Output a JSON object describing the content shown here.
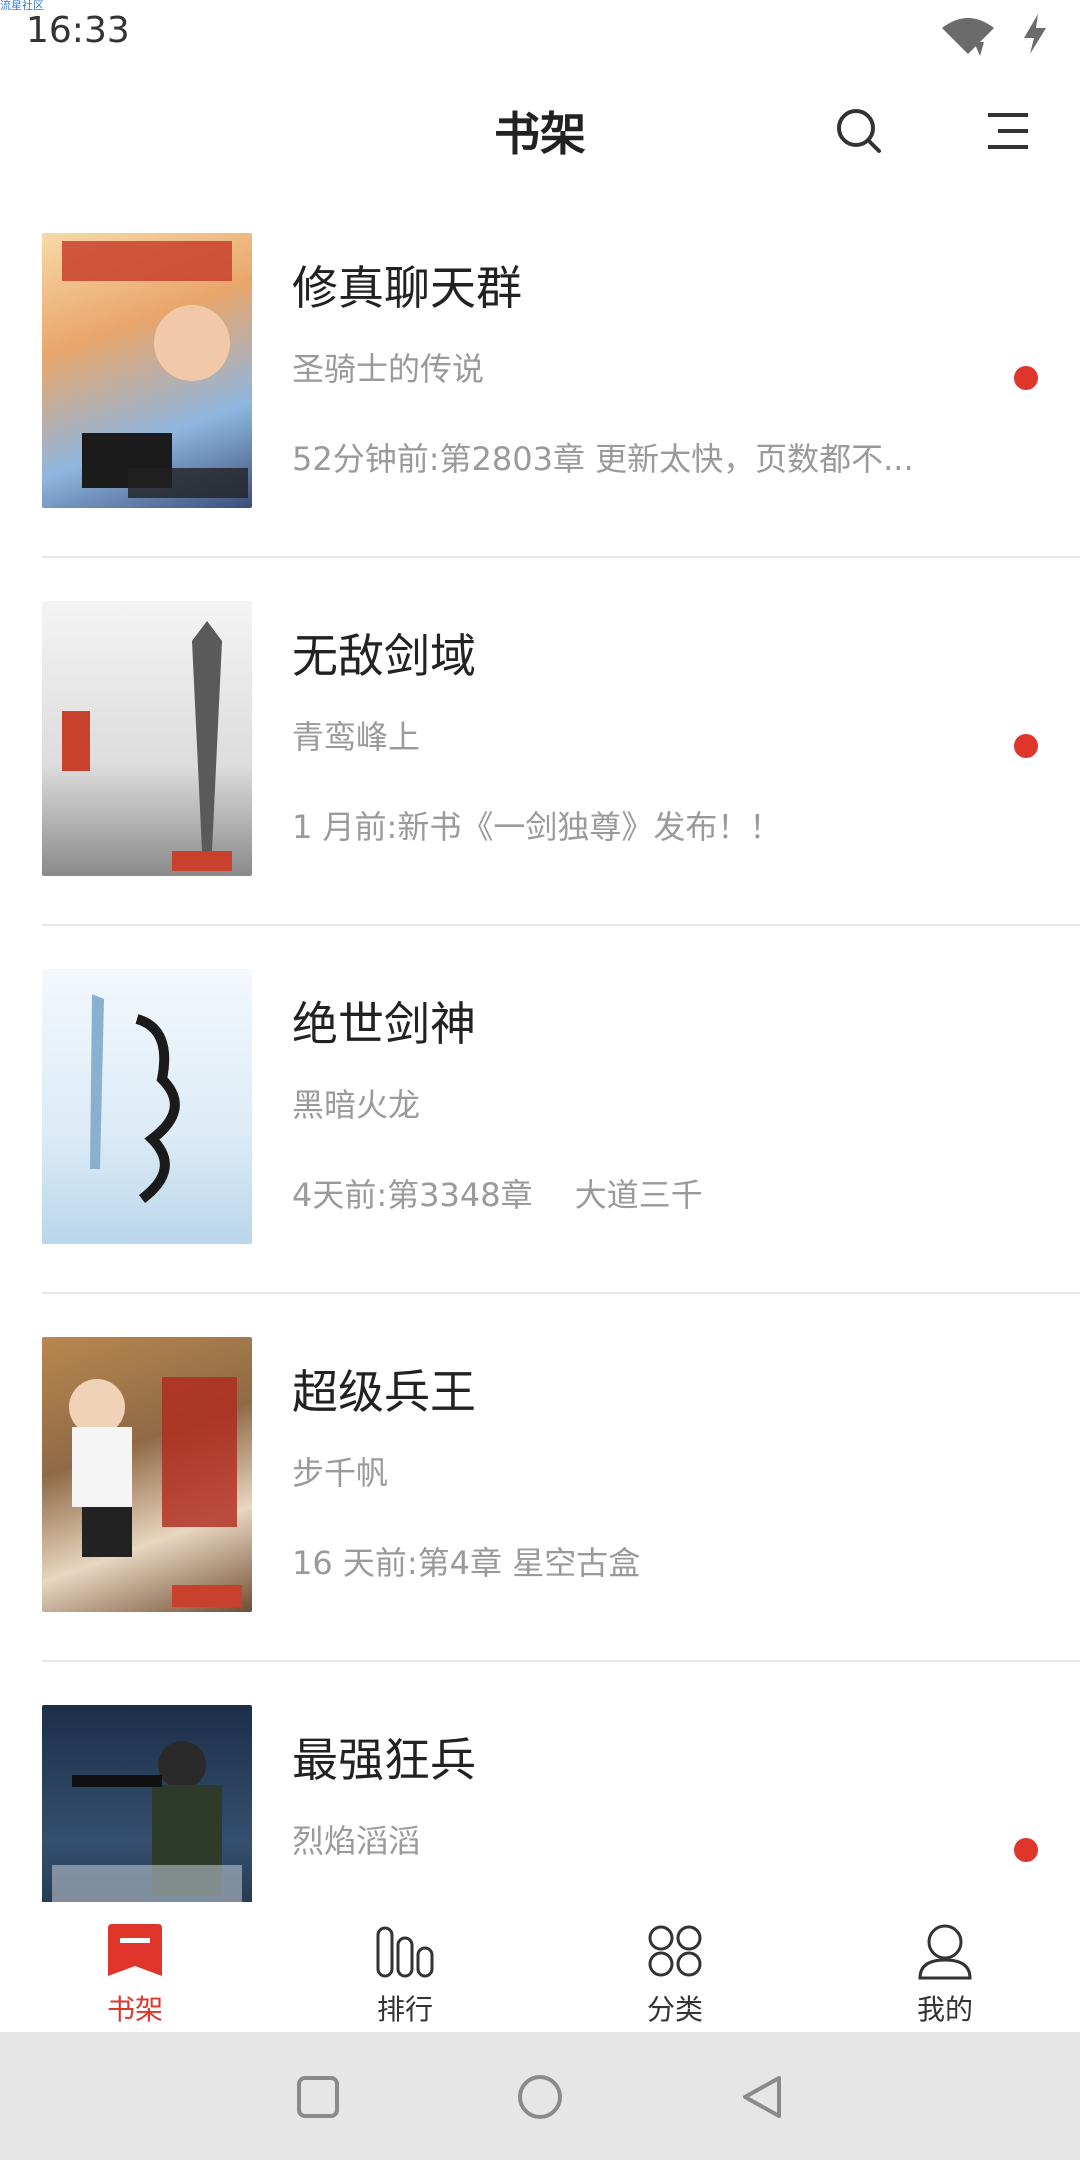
{
  "watermark": "流星社区",
  "status_bar": {
    "time": "16:33",
    "icons": [
      "wifi-icon",
      "charging-icon"
    ]
  },
  "header": {
    "title": "书架",
    "icons": [
      "search-icon",
      "menu-icon"
    ]
  },
  "books": [
    {
      "title": "修真聊天群",
      "author": "圣骑士的传说",
      "update": "52分钟前:第2803章 更新太快，页数都不...",
      "unread": true
    },
    {
      "title": "无敌剑域",
      "author": "青鸾峰上",
      "update": "1 月前:新书《一剑独尊》发布！！",
      "unread": true
    },
    {
      "title": "绝世剑神",
      "author": "黑暗火龙",
      "update": "4天前:第3348章　 大道三千",
      "unread": false
    },
    {
      "title": "超级兵王",
      "author": "步千帆",
      "update": "16 天前:第4章 星空古盒",
      "unread": false
    },
    {
      "title": "最强狂兵",
      "author": "烈焰滔滔",
      "update": "",
      "unread": true
    }
  ],
  "bottom_nav": [
    {
      "label": "书架",
      "icon": "bookmark-icon",
      "active": true
    },
    {
      "label": "排行",
      "icon": "ranking-icon",
      "active": false
    },
    {
      "label": "分类",
      "icon": "category-icon",
      "active": false
    },
    {
      "label": "我的",
      "icon": "profile-icon",
      "active": false
    }
  ],
  "system_nav": [
    "recent-apps-icon",
    "home-icon",
    "back-icon"
  ],
  "colors": {
    "accent": "#e0352b",
    "text_primary": "#222222",
    "text_secondary": "#9a9a9a",
    "divider": "#e8e8e8",
    "system_bar": "#e6e6e6"
  }
}
